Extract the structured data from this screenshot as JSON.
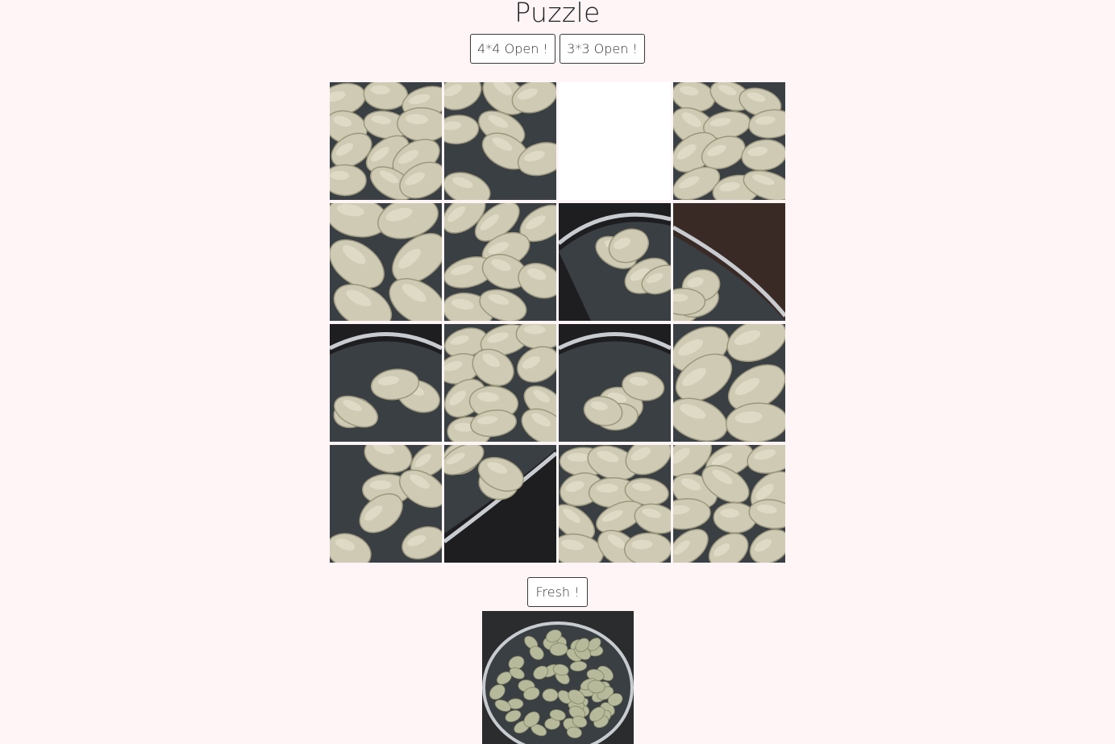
{
  "header": {
    "title": "Puzzle"
  },
  "controls": {
    "open4_label": "4*4 Open !",
    "open3_label": "3*3 Open !",
    "fresh_label": "Fresh !"
  },
  "board": {
    "grid_size": 4,
    "tiles": [
      {
        "index": 0,
        "empty": false,
        "variant": "dumplings-dense"
      },
      {
        "index": 1,
        "empty": false,
        "variant": "dumplings-water"
      },
      {
        "index": 2,
        "empty": true
      },
      {
        "index": 3,
        "empty": false,
        "variant": "dumplings-dense"
      },
      {
        "index": 4,
        "empty": false,
        "variant": "dumplings-closeup"
      },
      {
        "index": 5,
        "empty": false,
        "variant": "dumplings-water"
      },
      {
        "index": 6,
        "empty": false,
        "variant": "pan-rim"
      },
      {
        "index": 7,
        "empty": false,
        "variant": "pan-edge-dark"
      },
      {
        "index": 8,
        "empty": false,
        "variant": "pan-edge-top"
      },
      {
        "index": 9,
        "empty": false,
        "variant": "dumplings-dense"
      },
      {
        "index": 10,
        "empty": false,
        "variant": "pan-edge-top"
      },
      {
        "index": 11,
        "empty": false,
        "variant": "dumplings-closeup"
      },
      {
        "index": 12,
        "empty": false,
        "variant": "dumplings-water"
      },
      {
        "index": 13,
        "empty": false,
        "variant": "pan-rim-bottom"
      },
      {
        "index": 14,
        "empty": false,
        "variant": "dumplings-dense"
      },
      {
        "index": 15,
        "empty": false,
        "variant": "dumplings-water"
      }
    ]
  },
  "preview": {
    "description_icon": "dumplings-in-pan-photo"
  },
  "colors": {
    "background": "#fff5f7",
    "dumpling": "#cfcab3",
    "water": "#3a3f44",
    "pan_rim": "#c8ccd0",
    "pan_dark": "#1e1e20"
  }
}
